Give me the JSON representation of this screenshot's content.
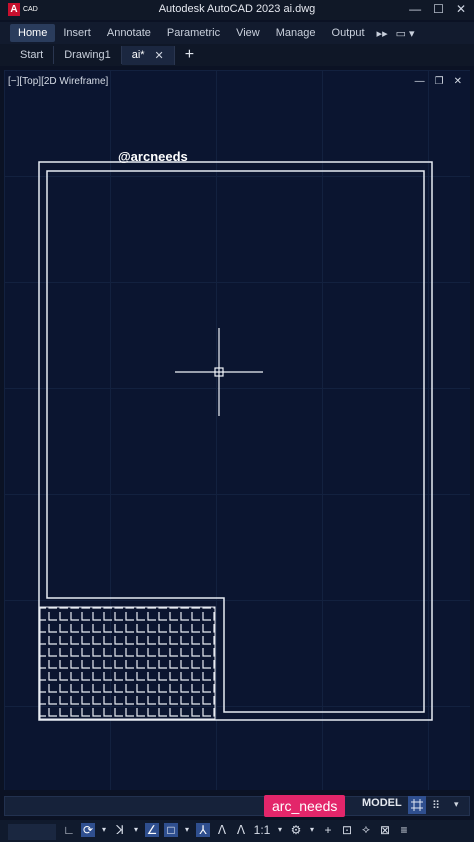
{
  "app": {
    "logo_letter": "A",
    "logo_text": "CAD",
    "title": "Autodesk AutoCAD 2023    ai.dwg"
  },
  "window_controls": [
    "—",
    "☐",
    "✕"
  ],
  "ribbon": {
    "tabs": [
      "Home",
      "Insert",
      "Annotate",
      "Parametric",
      "View",
      "Manage",
      "Output"
    ],
    "active": "Home",
    "more": "▸▸",
    "extra": "▭ ▾"
  },
  "doc_tabs": {
    "tabs": [
      "Start",
      "Drawing1"
    ],
    "active_tab": "ai*",
    "close": "✕",
    "new_tab": "+"
  },
  "viewport": {
    "label": "[−][Top][2D Wireframe]",
    "controls": [
      "—",
      "❐",
      "✕"
    ],
    "watermark": "@arcneeds"
  },
  "statusbar": {
    "user_badge": "arc_needs",
    "model": "MODEL",
    "grid_more": "⠿",
    "grid_caret": "▾",
    "tools": [
      "∟",
      "⟳",
      "▾",
      "ꓘ",
      "▾",
      "∠",
      "□",
      "▾",
      "⅄",
      "ᐱ",
      "ᐱ",
      "1:1",
      "▾",
      "⚙",
      "▾",
      "+",
      "⊡",
      "⟡",
      "⊠",
      "≡"
    ]
  },
  "colors": {
    "background": "#0b1224",
    "viewport": "#0b1530",
    "accent_badge": "#e3266a",
    "active_button": "#2f4f8f"
  }
}
